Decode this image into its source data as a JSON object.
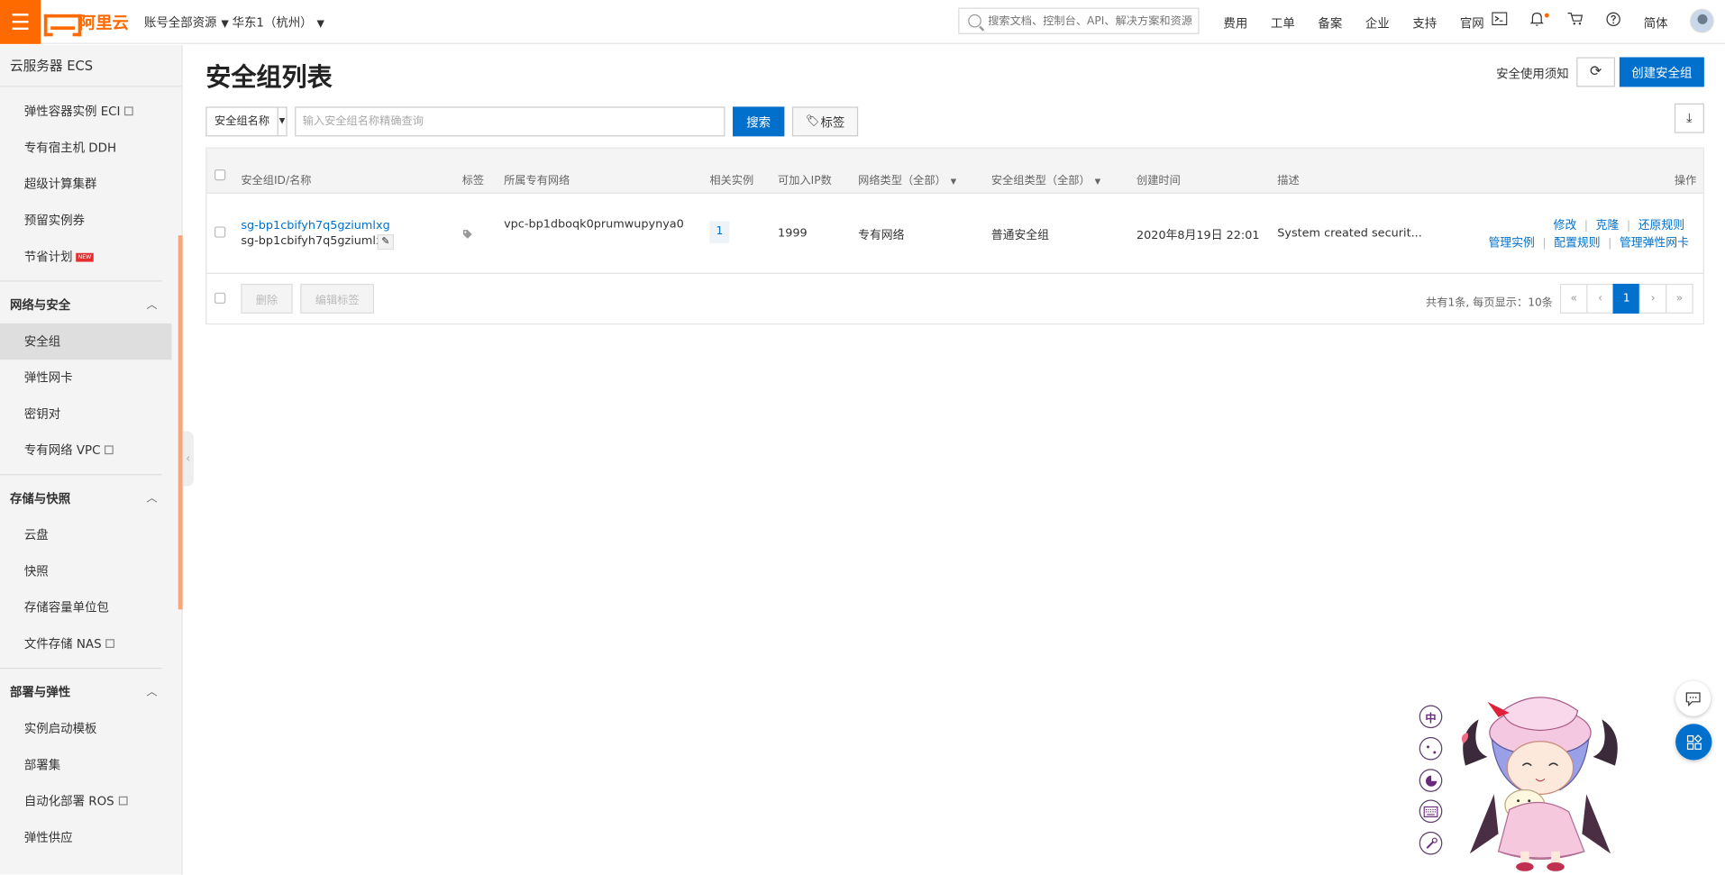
{
  "topbar": {
    "menu_icon": "hamburger-icon",
    "brand": "阿里云",
    "account_scope": "账号全部资源",
    "region": "华东1（杭州）",
    "search_placeholder": "搜索文档、控制台、API、解决方案和资源",
    "nav": [
      "费用",
      "工单",
      "备案",
      "企业",
      "支持",
      "官网"
    ],
    "icons": [
      "terminal-icon",
      "bell-icon",
      "cart-icon",
      "help-icon"
    ],
    "language": "简体"
  },
  "sidebar": {
    "title": "云服务器 ECS",
    "items_top": [
      {
        "label": "弹性容器实例 ECI",
        "external": true
      },
      {
        "label": "专有宿主机 DDH"
      },
      {
        "label": "超级计算集群"
      },
      {
        "label": "预留实例券"
      },
      {
        "label": "节省计划",
        "badge": "NEW"
      }
    ],
    "groups": [
      {
        "label": "网络与安全",
        "items": [
          {
            "label": "安全组",
            "active": true
          },
          {
            "label": "弹性网卡"
          },
          {
            "label": "密钥对"
          },
          {
            "label": "专有网络 VPC",
            "external": true
          }
        ]
      },
      {
        "label": "存储与快照",
        "items": [
          {
            "label": "云盘"
          },
          {
            "label": "快照"
          },
          {
            "label": "存储容量单位包"
          },
          {
            "label": "文件存储 NAS",
            "external": true
          }
        ]
      },
      {
        "label": "部署与弹性",
        "items": [
          {
            "label": "实例启动模板"
          },
          {
            "label": "部署集"
          },
          {
            "label": "自动化部署 ROS",
            "external": true
          },
          {
            "label": "弹性供应"
          }
        ]
      }
    ]
  },
  "main": {
    "title": "安全组列表",
    "notice_link": "安全使用须知",
    "create_button": "创建安全组",
    "filter": {
      "field": "安全组名称",
      "placeholder": "输入安全组名称精确查询",
      "search_button": "搜索",
      "tag_button": "标签"
    },
    "table": {
      "headers": {
        "id_name": "安全组ID/名称",
        "tag": "标签",
        "vpc": "所属专有网络",
        "instances": "相关实例",
        "ip_count": "可加入IP数",
        "net_type": "网络类型（全部）",
        "sg_type": "安全组类型（全部）",
        "created": "创建时间",
        "desc": "描述",
        "ops": "操作"
      },
      "rows": [
        {
          "id": "sg-bp1cbifyh7q5gziumlxg",
          "name": "sg-bp1cbifyh7q5gziumlx...",
          "vpc": "vpc-bp1dboqk0prumwupynya0",
          "instances": "1",
          "ip_count": "1999",
          "net_type": "专有网络",
          "sg_type": "普通安全组",
          "created": "2020年8月19日 22:01",
          "desc": "System created securit...",
          "ops_row1": [
            "修改",
            "克隆",
            "还原规则"
          ],
          "ops_row2": [
            "管理实例",
            "配置规则",
            "管理弹性网卡"
          ]
        }
      ]
    },
    "footer": {
      "delete": "删除",
      "edit_tags": "编辑标签",
      "page_info": "共有1条, 每页显示：10条",
      "pager": [
        "«",
        "‹",
        "1",
        "›",
        "»"
      ],
      "current_page": "1"
    }
  },
  "ime_toolbar": [
    "中",
    "",
    "",
    "",
    ""
  ],
  "colors": {
    "brand": "#ff6a00",
    "primary": "#0070cc"
  }
}
